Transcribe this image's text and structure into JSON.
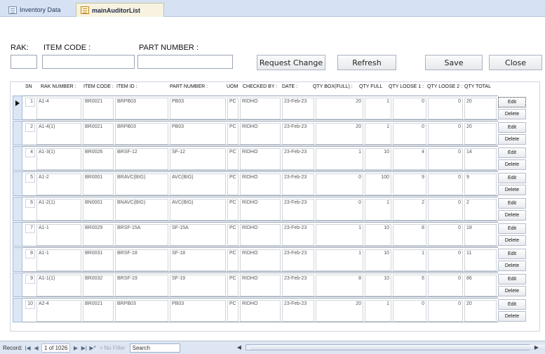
{
  "tabs": [
    {
      "label": "Inventory Data"
    },
    {
      "label": "mainAuditorList"
    }
  ],
  "header": {
    "rak_label": "RAK:",
    "item_code_label": "ITEM CODE :",
    "part_number_label": "PART NUMBER :",
    "rak_value": "",
    "item_code_value": "",
    "part_number_value": ""
  },
  "buttons": {
    "request_change": "Request Change",
    "refresh": "Refresh",
    "save": "Save",
    "close": "Close",
    "edit": "Edit",
    "delete": "Delete"
  },
  "columns": {
    "sn": "SN",
    "rak_number": "RAK NUMBER :",
    "item_code": "ITEM CODE :",
    "item_id": "ITEM ID :",
    "part_number": "PART NUMBER :",
    "uom": "UOM",
    "checked_by": "CHECKED BY :",
    "date": "DATE :",
    "qty_box_full": "QTY BOX(FULL) :",
    "qty_full": "QTY FULL",
    "qty_loose1": "QTY LOOSE 1 :",
    "qty_loose2": "QTY LOOSE 2 :",
    "qty_total": "QTY TOTAL"
  },
  "rows": [
    {
      "sn": "1",
      "rak": "A1-4",
      "item_code": "BR0021",
      "item_id": "BRPB03",
      "part": "PB03",
      "uom": "PC",
      "checked_by": "RIDHO",
      "date": "23-Feb-23",
      "box": "20",
      "full": "1",
      "loose1": "0",
      "loose2": "0",
      "total": "20"
    },
    {
      "sn": "2",
      "rak": "A1-4(1)",
      "item_code": "BR0021",
      "item_id": "BRPB03",
      "part": "PB03",
      "uom": "PC",
      "checked_by": "RIDHO",
      "date": "23-Feb-23",
      "box": "20",
      "full": "1",
      "loose1": "0",
      "loose2": "0",
      "total": "20"
    },
    {
      "sn": "4",
      "rak": "A1-3(1)",
      "item_code": "BR0026",
      "item_id": "BRSF-12",
      "part": "SF-12",
      "uom": "PC",
      "checked_by": "RIDHO",
      "date": "23-Feb-23",
      "box": "1",
      "full": "10",
      "loose1": "4",
      "loose2": "0",
      "total": "14"
    },
    {
      "sn": "5",
      "rak": "A1-2",
      "item_code": "BR0001",
      "item_id": "BRAVC(BIG)",
      "part": "AVC(BIG)",
      "uom": "PC",
      "checked_by": "RIDHO",
      "date": "23-Feb-23",
      "box": "0",
      "full": "100",
      "loose1": "9",
      "loose2": "0",
      "total": "9"
    },
    {
      "sn": "6",
      "rak": "A1-2(1)",
      "item_code": "BN0001",
      "item_id": "BNAVC(BIG)",
      "part": "AVC(BIG)",
      "uom": "PC",
      "checked_by": "RIDHO",
      "date": "23-Feb-23",
      "box": "0",
      "full": "1",
      "loose1": "2",
      "loose2": "0",
      "total": "2"
    },
    {
      "sn": "7",
      "rak": "A1-1",
      "item_code": "BR0029",
      "item_id": "BRSF-15A",
      "part": "SF-15A",
      "uom": "PC",
      "checked_by": "RIDHO",
      "date": "23-Feb-23",
      "box": "1",
      "full": "10",
      "loose1": "8",
      "loose2": "0",
      "total": "18"
    },
    {
      "sn": "8",
      "rak": "A1-1",
      "item_code": "BR0031",
      "item_id": "BRSF-18",
      "part": "SF-18",
      "uom": "PC",
      "checked_by": "RIDHO",
      "date": "23-Feb-23",
      "box": "1",
      "full": "10",
      "loose1": "1",
      "loose2": "0",
      "total": "11"
    },
    {
      "sn": "9",
      "rak": "A1-1(1)",
      "item_code": "BR0032",
      "item_id": "BRSF-19",
      "part": "SF-19",
      "uom": "PC",
      "checked_by": "RIDHO",
      "date": "23-Feb-23",
      "box": "8",
      "full": "10",
      "loose1": "6",
      "loose2": "0",
      "total": "86"
    },
    {
      "sn": "10",
      "rak": "A2-4",
      "item_code": "BR0021",
      "item_id": "BRPB03",
      "part": "PB03",
      "uom": "PC",
      "checked_by": "RIDHO",
      "date": "23-Feb-23",
      "box": "20",
      "full": "1",
      "loose1": "0",
      "loose2": "0",
      "total": "20"
    }
  ],
  "statusbar": {
    "record_label": "Record:",
    "record_position": "1 of 1026",
    "no_filter": "No Filter",
    "search_placeholder": "Search"
  },
  "icons": {
    "current_record": "record-selector-arrow-icon",
    "tab_form": "form-icon",
    "filter": "funnel-icon"
  }
}
